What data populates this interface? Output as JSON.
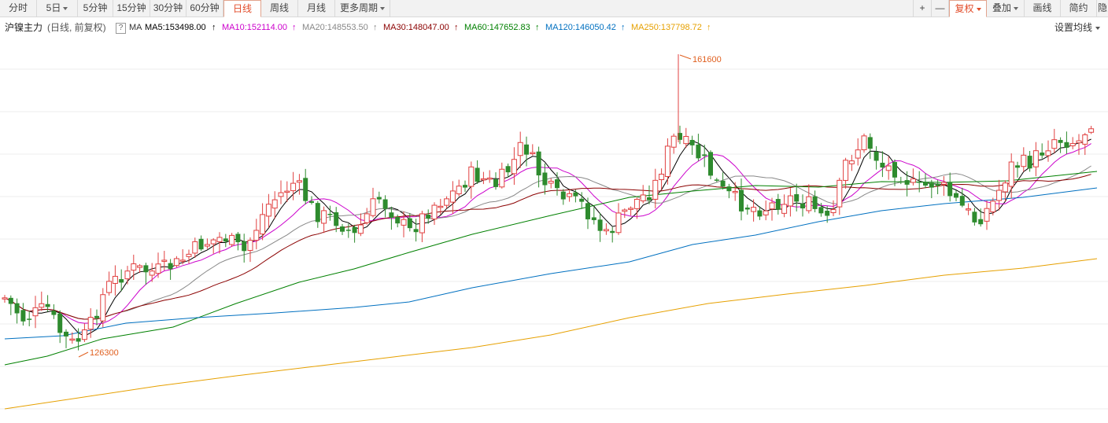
{
  "toolbar": {
    "periods": [
      "分时",
      "5日",
      "5分钟",
      "15分钟",
      "30分钟",
      "60分钟",
      "日线",
      "周线",
      "月线",
      "更多周期"
    ],
    "active_period": "日线",
    "zoom_in": "+",
    "zoom_out": "—",
    "adjust": "复权",
    "overlay": "叠加",
    "draw": "画线",
    "simple": "简约",
    "hide": "隐"
  },
  "ma_bar": {
    "instrument": "沪镍主力",
    "mode": "(日线, 前复权)",
    "help": "?",
    "ma_label": "MA",
    "ma5": "MA5:153498.00",
    "ma10": "MA10:152114.00",
    "ma20": "MA20:148553.50",
    "ma30": "MA30:148047.00",
    "ma60": "MA60:147652.83",
    "ma120": "MA120:146050.42",
    "ma250": "MA250:137798.72",
    "arrow": "↑",
    "settings": "设置均线"
  },
  "colors": {
    "ma5": "#000000",
    "ma10": "#cc00cc",
    "ma20": "#888888",
    "ma30": "#8b0000",
    "ma60": "#008000",
    "ma120": "#0070c0",
    "ma250": "#e6a000",
    "up": "#e04040",
    "down": "#2e8b2e",
    "annotation": "#e06020"
  },
  "annotations": {
    "high": "161600",
    "low": "126300"
  }
}
